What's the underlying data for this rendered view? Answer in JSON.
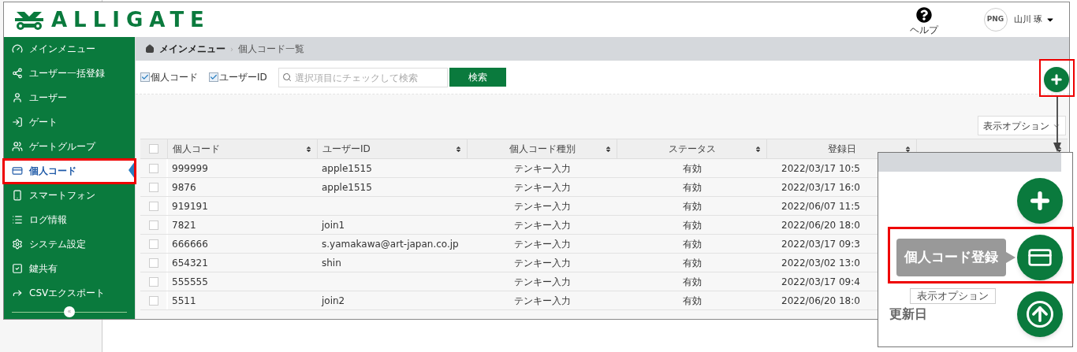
{
  "header": {
    "logo": "ALLIGATE",
    "help": "ヘルプ",
    "avatar_label": "PNG",
    "user_name": "山川 琢"
  },
  "sidebar": {
    "items": [
      {
        "label": "メインメニュー",
        "selected": false
      },
      {
        "label": "ユーザー一括登録",
        "selected": false
      },
      {
        "label": "ユーザー",
        "selected": false
      },
      {
        "label": "ゲート",
        "selected": false
      },
      {
        "label": "ゲートグループ",
        "selected": false
      },
      {
        "label": "個人コード",
        "selected": true
      },
      {
        "label": "スマートフォン",
        "selected": false
      },
      {
        "label": "ログ情報",
        "selected": false
      },
      {
        "label": "システム設定",
        "selected": false
      },
      {
        "label": "鍵共有",
        "selected": false
      },
      {
        "label": "CSVエクスポート",
        "selected": false
      }
    ],
    "collapse_glyph": "«"
  },
  "breadcrumb": {
    "home": "メインメニュー",
    "separator": "›",
    "current": "個人コード一覧"
  },
  "filters": [
    {
      "label": "個人コード",
      "checked": true
    },
    {
      "label": "ユーザーID",
      "checked": true
    }
  ],
  "search": {
    "placeholder": "選択項目にチェックして検索",
    "button": "検索"
  },
  "display_options": "表示オプション",
  "table": {
    "header_checked": false,
    "columns": [
      "個人コード",
      "ユーザーID",
      "個人コード種別",
      "ステータス",
      "登録日"
    ],
    "rows": [
      {
        "checked": false,
        "cells": [
          "999999",
          "apple1515",
          "テンキー入力",
          "有効",
          "2022/03/17 10:5"
        ]
      },
      {
        "checked": false,
        "cells": [
          "9876",
          "apple1515",
          "テンキー入力",
          "有効",
          "2022/03/17 16:0"
        ]
      },
      {
        "checked": false,
        "cells": [
          "919191",
          "",
          "テンキー入力",
          "有効",
          "2022/06/07 11:5"
        ]
      },
      {
        "checked": false,
        "cells": [
          "7821",
          "join1",
          "テンキー入力",
          "有効",
          "2022/06/20 18:0"
        ]
      },
      {
        "checked": false,
        "cells": [
          "666666",
          "s.yamakawa@art-japan.co.jp",
          "テンキー入力",
          "有効",
          "2022/03/17 09:3"
        ]
      },
      {
        "checked": false,
        "cells": [
          "654321",
          "shin",
          "テンキー入力",
          "有効",
          "2022/03/02 13:0"
        ]
      },
      {
        "checked": false,
        "cells": [
          "555555",
          "",
          "テンキー入力",
          "有効",
          "2022/03/17 09:4"
        ]
      },
      {
        "checked": false,
        "cells": [
          "5511",
          "join2",
          "テンキー入力",
          "有効",
          "2022/06/20 18:0"
        ]
      }
    ]
  },
  "inset": {
    "tooltip": "個人コード登録",
    "display_options": "表示オプション",
    "column": "更新日"
  }
}
